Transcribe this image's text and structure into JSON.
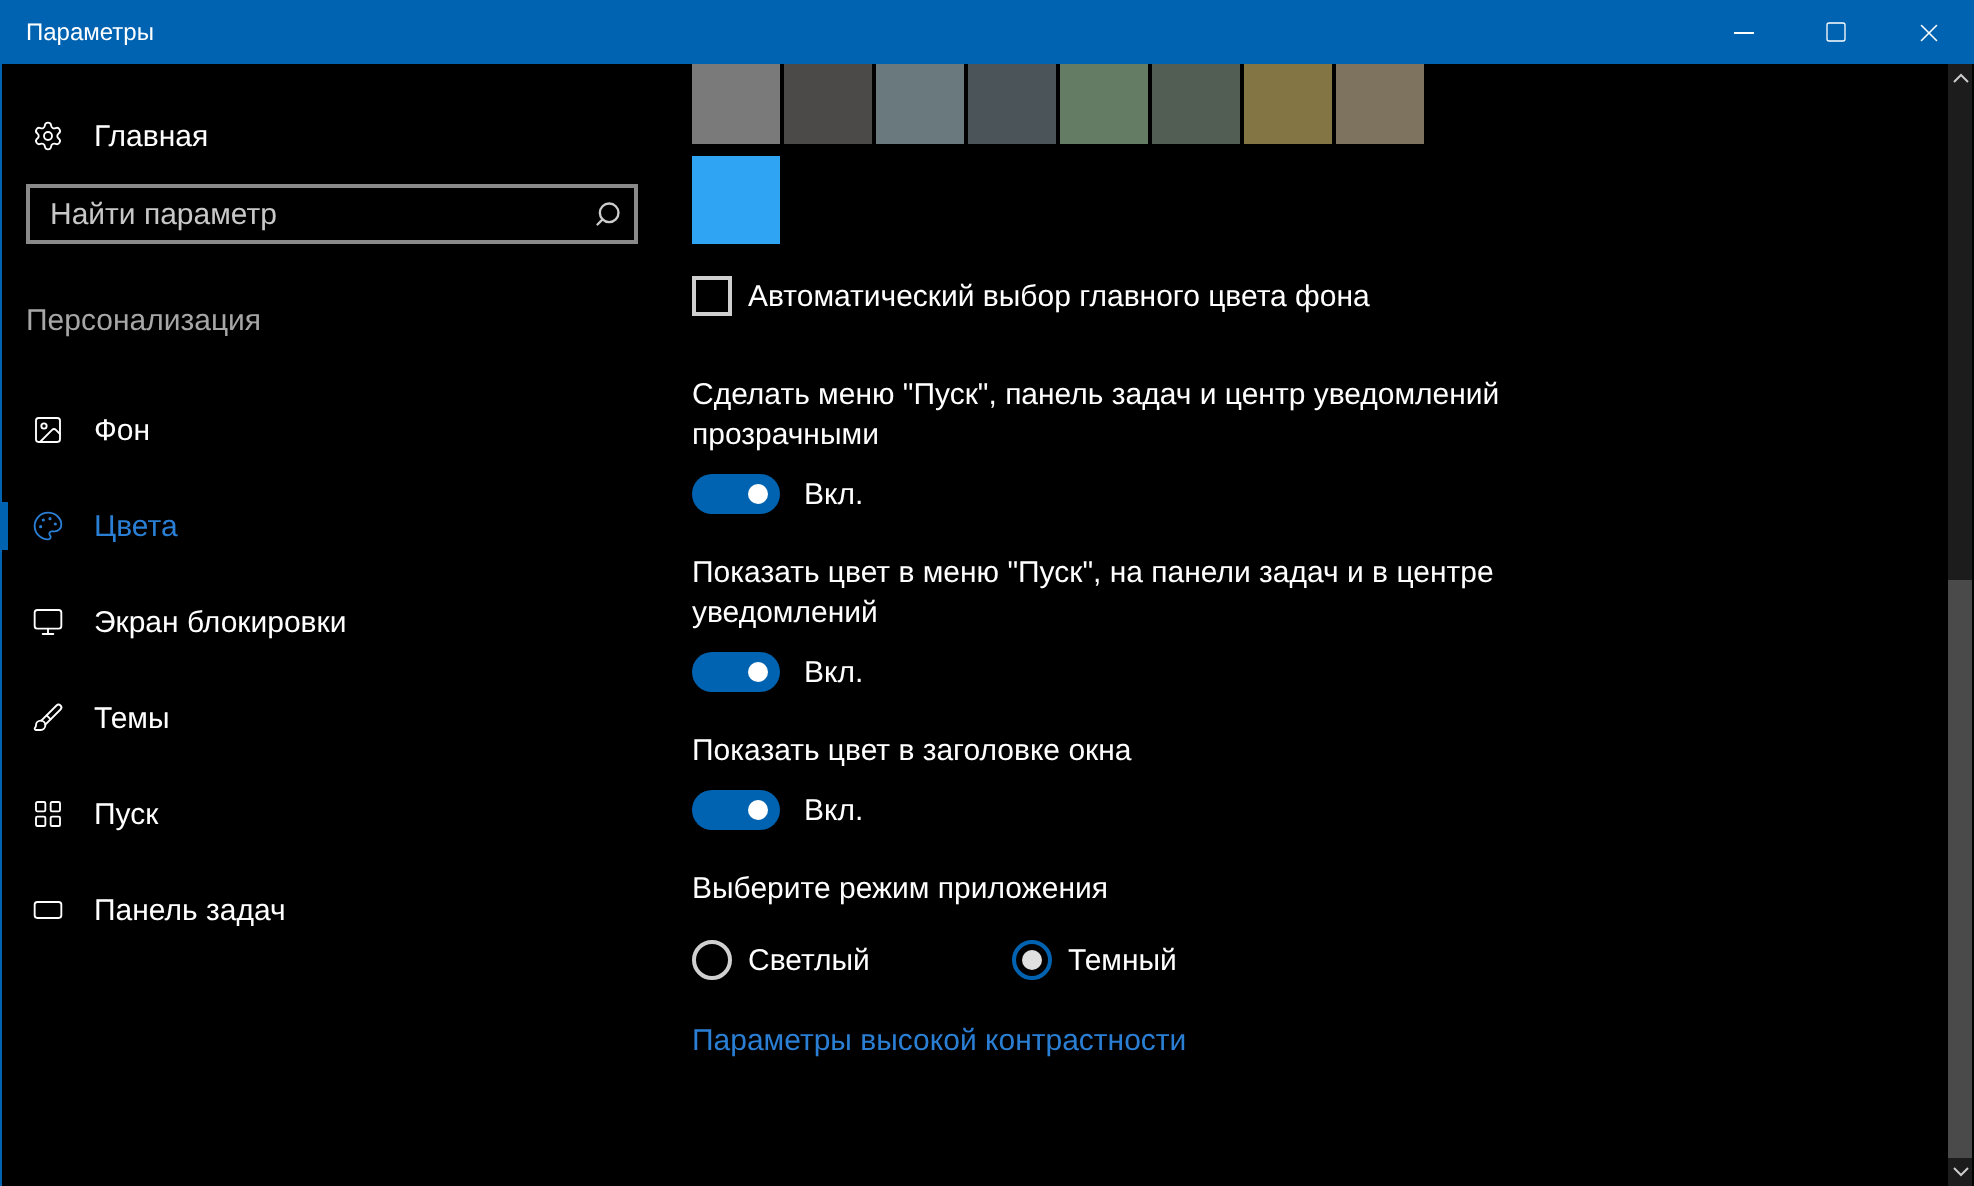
{
  "window": {
    "title": "Параметры"
  },
  "sidebar": {
    "home": "Главная",
    "search": {
      "placeholder": "Найти параметр"
    },
    "section": "Персонализация",
    "items": [
      {
        "label": "Фон",
        "selected": false
      },
      {
        "label": "Цвета",
        "selected": true
      },
      {
        "label": "Экран блокировки",
        "selected": false
      },
      {
        "label": "Темы",
        "selected": false
      },
      {
        "label": "Пуск",
        "selected": false
      },
      {
        "label": "Панель задач",
        "selected": false
      }
    ]
  },
  "content": {
    "swatches": [
      {
        "color": "#7a7a7a"
      },
      {
        "color": "#4c4a48"
      },
      {
        "color": "#69797e"
      },
      {
        "color": "#4a5459"
      },
      {
        "color": "#647c64"
      },
      {
        "color": "#525e54"
      },
      {
        "color": "#847545"
      },
      {
        "color": "#7e735f"
      },
      {
        "color": "#2ea4f2"
      }
    ],
    "auto_color": {
      "label": "Автоматический выбор главного цвета фона",
      "checked": false
    },
    "toggles": [
      {
        "label": "Сделать меню \"Пуск\", панель задач и центр уведомлений прозрачными",
        "on": true,
        "state": "Вкл."
      },
      {
        "label": "Показать цвет в меню \"Пуск\", на панели задач и в центре уведомлений",
        "on": true,
        "state": "Вкл."
      },
      {
        "label": "Показать цвет в заголовке окна",
        "on": true,
        "state": "Вкл."
      }
    ],
    "mode": {
      "heading": "Выберите режим приложения",
      "options": [
        {
          "label": "Светлый",
          "selected": false
        },
        {
          "label": "Темный",
          "selected": true
        }
      ]
    },
    "link": "Параметры высокой контрастности"
  }
}
